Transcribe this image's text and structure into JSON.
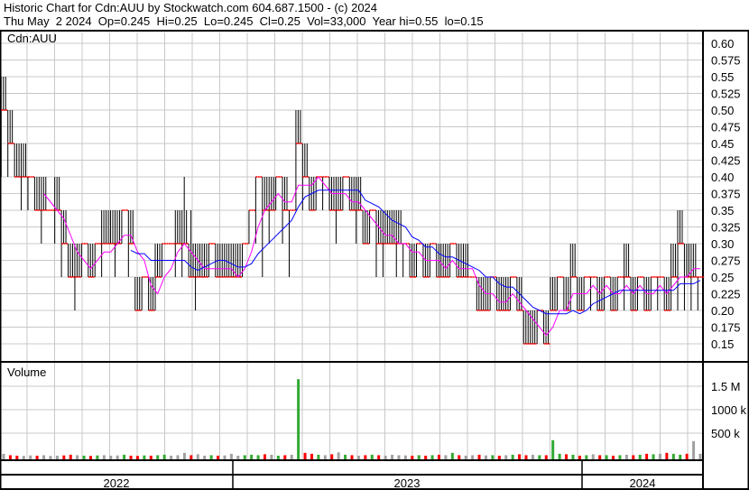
{
  "header": {
    "line1": "Historic Chart for Cdn:AUU by Stockwatch.com 604.687.1500 - (c) 2024",
    "line2": "Thu May  2 2024  Op=0.245  Hi=0.25  Lo=0.245  Cl=0.25  Vol=33,000  Year hi=0.55  lo=0.15"
  },
  "colors": {
    "bar": "#000000",
    "close_tick": "#ff0000",
    "ma_short": "#ff00ff",
    "ma_long": "#0000ff",
    "vol_up": "#33aa33",
    "vol_down": "#ff0000",
    "vol_flat": "#a0a0a0",
    "grid": "#c8c8c8"
  },
  "chart_data": [
    {
      "type": "line",
      "title": "Cdn:AUU",
      "ylim": [
        0.125,
        0.625
      ],
      "yticks": [
        "0.60",
        "0.575",
        "0.55",
        "0.525",
        "0.50",
        "0.475",
        "0.45",
        "0.425",
        "0.40",
        "0.375",
        "0.35",
        "0.325",
        "0.30",
        "0.275",
        "0.25",
        "0.225",
        "0.20",
        "0.175",
        "0.15"
      ],
      "x_labels": [
        "2022",
        "2023",
        "2024"
      ],
      "high": [
        0.55,
        0.5,
        0.45,
        0.45,
        0.4,
        0.4,
        0.4,
        0.35,
        0.4,
        0.35,
        0.3,
        0.3,
        0.3,
        0.3,
        0.3,
        0.35,
        0.35,
        0.35,
        0.35,
        0.35,
        0.25,
        0.25,
        0.25,
        0.3,
        0.3,
        0.3,
        0.35,
        0.4,
        0.35,
        0.3,
        0.3,
        0.3,
        0.3,
        0.3,
        0.3,
        0.3,
        0.3,
        0.35,
        0.4,
        0.4,
        0.4,
        0.4,
        0.4,
        0.35,
        0.5,
        0.45,
        0.4,
        0.4,
        0.4,
        0.4,
        0.4,
        0.4,
        0.4,
        0.4,
        0.35,
        0.35,
        0.35,
        0.35,
        0.35,
        0.35,
        0.3,
        0.3,
        0.3,
        0.3,
        0.3,
        0.3,
        0.3,
        0.3,
        0.3,
        0.3,
        0.25,
        0.25,
        0.25,
        0.25,
        0.25,
        0.25,
        0.25,
        0.25,
        0.2,
        0.2,
        0.2,
        0.2,
        0.25,
        0.25,
        0.25,
        0.3,
        0.25,
        0.25,
        0.25,
        0.25,
        0.25,
        0.25,
        0.25,
        0.3,
        0.25,
        0.25,
        0.25,
        0.25,
        0.25,
        0.25,
        0.3,
        0.35,
        0.3,
        0.3,
        0.25
      ],
      "low": [
        0.4,
        0.4,
        0.4,
        0.35,
        0.35,
        0.35,
        0.3,
        0.35,
        0.3,
        0.25,
        0.25,
        0.2,
        0.25,
        0.25,
        0.25,
        0.25,
        0.3,
        0.25,
        0.3,
        0.25,
        0.2,
        0.2,
        0.2,
        0.2,
        0.25,
        0.3,
        0.25,
        0.25,
        0.25,
        0.2,
        0.25,
        0.25,
        0.25,
        0.25,
        0.25,
        0.25,
        0.25,
        0.3,
        0.3,
        0.25,
        0.3,
        0.35,
        0.3,
        0.25,
        0.35,
        0.35,
        0.35,
        0.35,
        0.35,
        0.35,
        0.3,
        0.35,
        0.35,
        0.3,
        0.3,
        0.3,
        0.25,
        0.25,
        0.3,
        0.25,
        0.25,
        0.25,
        0.25,
        0.25,
        0.25,
        0.25,
        0.25,
        0.25,
        0.25,
        0.25,
        0.25,
        0.2,
        0.2,
        0.2,
        0.2,
        0.2,
        0.2,
        0.2,
        0.15,
        0.15,
        0.15,
        0.15,
        0.2,
        0.2,
        0.2,
        0.2,
        0.2,
        0.2,
        0.2,
        0.2,
        0.2,
        0.2,
        0.2,
        0.2,
        0.2,
        0.2,
        0.2,
        0.2,
        0.2,
        0.2,
        0.2,
        0.2,
        0.2,
        0.2,
        0.2
      ],
      "close": [
        0.5,
        0.45,
        0.4,
        0.4,
        0.4,
        0.35,
        0.35,
        0.35,
        0.35,
        0.3,
        0.25,
        0.25,
        0.3,
        0.25,
        0.3,
        0.3,
        0.3,
        0.3,
        0.35,
        0.3,
        0.2,
        0.25,
        0.2,
        0.25,
        0.3,
        0.3,
        0.3,
        0.3,
        0.25,
        0.25,
        0.25,
        0.3,
        0.25,
        0.25,
        0.25,
        0.25,
        0.3,
        0.35,
        0.4,
        0.35,
        0.35,
        0.4,
        0.35,
        0.35,
        0.45,
        0.4,
        0.35,
        0.4,
        0.4,
        0.35,
        0.35,
        0.4,
        0.35,
        0.35,
        0.3,
        0.35,
        0.3,
        0.3,
        0.3,
        0.3,
        0.3,
        0.25,
        0.3,
        0.25,
        0.3,
        0.25,
        0.25,
        0.3,
        0.25,
        0.25,
        0.25,
        0.2,
        0.2,
        0.25,
        0.2,
        0.2,
        0.25,
        0.2,
        0.15,
        0.15,
        0.2,
        0.15,
        0.2,
        0.25,
        0.2,
        0.25,
        0.2,
        0.25,
        0.25,
        0.2,
        0.25,
        0.2,
        0.25,
        0.25,
        0.2,
        0.25,
        0.2,
        0.25,
        0.25,
        0.2,
        0.25,
        0.3,
        0.25,
        0.25,
        0.25
      ]
    },
    {
      "type": "bar",
      "title": "Volume",
      "yticks": [
        "1.5 M",
        "1000 k",
        "500 k"
      ],
      "ylim": [
        0,
        1800000
      ],
      "values": [
        60000,
        30000,
        20000,
        15000,
        25000,
        20000,
        30000,
        15000,
        20000,
        25000,
        40000,
        30000,
        20000,
        15000,
        25000,
        30000,
        20000,
        25000,
        40000,
        20000,
        15000,
        25000,
        20000,
        30000,
        40000,
        20000,
        30000,
        80000,
        30000,
        50000,
        20000,
        30000,
        20000,
        25000,
        60000,
        20000,
        30000,
        40000,
        30000,
        50000,
        40000,
        20000,
        30000,
        40000,
        1650000,
        80000,
        60000,
        40000,
        30000,
        50000,
        90000,
        40000,
        30000,
        20000,
        30000,
        40000,
        30000,
        20000,
        40000,
        30000,
        25000,
        20000,
        30000,
        20000,
        30000,
        40000,
        30000,
        80000,
        30000,
        20000,
        30000,
        40000,
        25000,
        30000,
        20000,
        30000,
        40000,
        50000,
        30000,
        40000,
        30000,
        30000,
        350000,
        60000,
        50000,
        40000,
        20000,
        30000,
        50000,
        30000,
        30000,
        20000,
        30000,
        40000,
        30000,
        40000,
        60000,
        50000,
        60000,
        80000,
        60000,
        40000,
        60000,
        330000,
        60000
      ],
      "colors_by_change": true
    }
  ]
}
